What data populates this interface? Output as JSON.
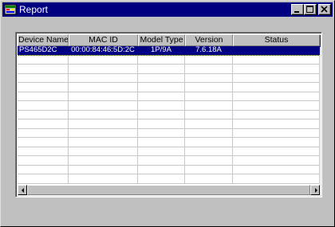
{
  "window": {
    "title": "Report",
    "icon": "report-app-icon",
    "controls": [
      "minimize-icon",
      "maximize-icon",
      "close-icon"
    ]
  },
  "table": {
    "columns": [
      "Device Name",
      "MAC ID",
      "Model Type",
      "Version",
      "Status"
    ],
    "rows": [
      [
        "PS465D2C",
        "00:00:84:46:5D:2C",
        "1P/9A",
        "7.6.18A",
        ""
      ]
    ],
    "empty_rows": 14,
    "selected_row": 0
  },
  "colors": {
    "titlebar": "#000080",
    "selection": "#000080",
    "face": "#c0c0c0"
  }
}
